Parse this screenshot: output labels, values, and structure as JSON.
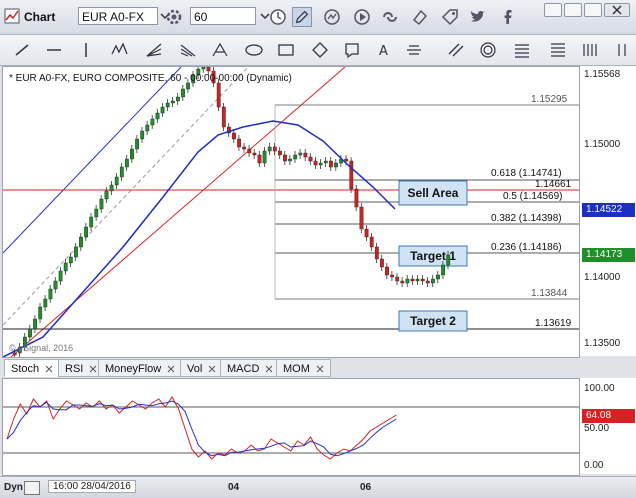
{
  "window": {
    "title": "Chart"
  },
  "toolbar": {
    "symbol": "EUR A0-FX",
    "interval": "60"
  },
  "chart": {
    "info": "* EUR A0-FX, EURO COMPOSITE, 60 - 00:00-00:00 (Dynamic)",
    "watermark": "© eSignal, 2016",
    "price_labels": [
      "1.15568",
      "1.15000",
      "1.14500",
      "1.14000",
      "1.13500"
    ],
    "current_price": "1.14173",
    "blue_line_price": "1.14522",
    "fib_levels": [
      "0.618 (1.14741)",
      "0.5 (1.14569)",
      "0.382 (1.14398)",
      "0.236 (1.14186)"
    ],
    "level_labels": {
      "top": "1.15295",
      "red": "1.14661",
      "bottom": "1.13844",
      "target2": "1.13619"
    },
    "boxes": {
      "sell_area": "Sell Area",
      "target1": "Target 1",
      "target2": "Target 2"
    },
    "colors": {
      "bull": "#1f8f2a",
      "bear": "#cc2222",
      "ma": "#1c2ec4",
      "channel": "#2233cc",
      "trend": "#dd2222"
    }
  },
  "indicator_tabs": [
    "Stoch",
    "RSI",
    "MoneyFlow",
    "Vol",
    "MACD",
    "MOM"
  ],
  "oscillator": {
    "labels": [
      "100.00",
      "50.00",
      "0.00"
    ],
    "value": "64.08"
  },
  "statusbar": {
    "mode": "Dyn",
    "datetime": "16:00 28/04/2016",
    "ticks": [
      "04",
      "06"
    ]
  }
}
